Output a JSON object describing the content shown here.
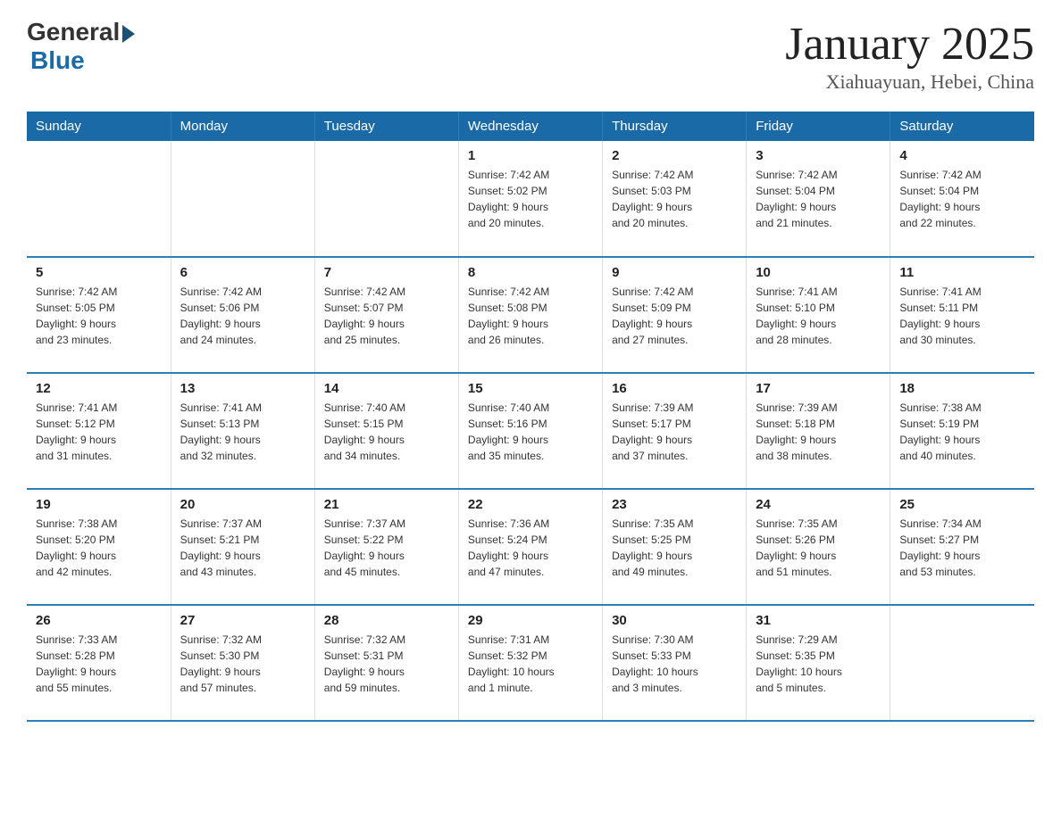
{
  "logo": {
    "general": "General",
    "blue": "Blue"
  },
  "title": "January 2025",
  "subtitle": "Xiahuayuan, Hebei, China",
  "days_of_week": [
    "Sunday",
    "Monday",
    "Tuesday",
    "Wednesday",
    "Thursday",
    "Friday",
    "Saturday"
  ],
  "weeks": [
    [
      {
        "day": "",
        "info": ""
      },
      {
        "day": "",
        "info": ""
      },
      {
        "day": "",
        "info": ""
      },
      {
        "day": "1",
        "info": "Sunrise: 7:42 AM\nSunset: 5:02 PM\nDaylight: 9 hours\nand 20 minutes."
      },
      {
        "day": "2",
        "info": "Sunrise: 7:42 AM\nSunset: 5:03 PM\nDaylight: 9 hours\nand 20 minutes."
      },
      {
        "day": "3",
        "info": "Sunrise: 7:42 AM\nSunset: 5:04 PM\nDaylight: 9 hours\nand 21 minutes."
      },
      {
        "day": "4",
        "info": "Sunrise: 7:42 AM\nSunset: 5:04 PM\nDaylight: 9 hours\nand 22 minutes."
      }
    ],
    [
      {
        "day": "5",
        "info": "Sunrise: 7:42 AM\nSunset: 5:05 PM\nDaylight: 9 hours\nand 23 minutes."
      },
      {
        "day": "6",
        "info": "Sunrise: 7:42 AM\nSunset: 5:06 PM\nDaylight: 9 hours\nand 24 minutes."
      },
      {
        "day": "7",
        "info": "Sunrise: 7:42 AM\nSunset: 5:07 PM\nDaylight: 9 hours\nand 25 minutes."
      },
      {
        "day": "8",
        "info": "Sunrise: 7:42 AM\nSunset: 5:08 PM\nDaylight: 9 hours\nand 26 minutes."
      },
      {
        "day": "9",
        "info": "Sunrise: 7:42 AM\nSunset: 5:09 PM\nDaylight: 9 hours\nand 27 minutes."
      },
      {
        "day": "10",
        "info": "Sunrise: 7:41 AM\nSunset: 5:10 PM\nDaylight: 9 hours\nand 28 minutes."
      },
      {
        "day": "11",
        "info": "Sunrise: 7:41 AM\nSunset: 5:11 PM\nDaylight: 9 hours\nand 30 minutes."
      }
    ],
    [
      {
        "day": "12",
        "info": "Sunrise: 7:41 AM\nSunset: 5:12 PM\nDaylight: 9 hours\nand 31 minutes."
      },
      {
        "day": "13",
        "info": "Sunrise: 7:41 AM\nSunset: 5:13 PM\nDaylight: 9 hours\nand 32 minutes."
      },
      {
        "day": "14",
        "info": "Sunrise: 7:40 AM\nSunset: 5:15 PM\nDaylight: 9 hours\nand 34 minutes."
      },
      {
        "day": "15",
        "info": "Sunrise: 7:40 AM\nSunset: 5:16 PM\nDaylight: 9 hours\nand 35 minutes."
      },
      {
        "day": "16",
        "info": "Sunrise: 7:39 AM\nSunset: 5:17 PM\nDaylight: 9 hours\nand 37 minutes."
      },
      {
        "day": "17",
        "info": "Sunrise: 7:39 AM\nSunset: 5:18 PM\nDaylight: 9 hours\nand 38 minutes."
      },
      {
        "day": "18",
        "info": "Sunrise: 7:38 AM\nSunset: 5:19 PM\nDaylight: 9 hours\nand 40 minutes."
      }
    ],
    [
      {
        "day": "19",
        "info": "Sunrise: 7:38 AM\nSunset: 5:20 PM\nDaylight: 9 hours\nand 42 minutes."
      },
      {
        "day": "20",
        "info": "Sunrise: 7:37 AM\nSunset: 5:21 PM\nDaylight: 9 hours\nand 43 minutes."
      },
      {
        "day": "21",
        "info": "Sunrise: 7:37 AM\nSunset: 5:22 PM\nDaylight: 9 hours\nand 45 minutes."
      },
      {
        "day": "22",
        "info": "Sunrise: 7:36 AM\nSunset: 5:24 PM\nDaylight: 9 hours\nand 47 minutes."
      },
      {
        "day": "23",
        "info": "Sunrise: 7:35 AM\nSunset: 5:25 PM\nDaylight: 9 hours\nand 49 minutes."
      },
      {
        "day": "24",
        "info": "Sunrise: 7:35 AM\nSunset: 5:26 PM\nDaylight: 9 hours\nand 51 minutes."
      },
      {
        "day": "25",
        "info": "Sunrise: 7:34 AM\nSunset: 5:27 PM\nDaylight: 9 hours\nand 53 minutes."
      }
    ],
    [
      {
        "day": "26",
        "info": "Sunrise: 7:33 AM\nSunset: 5:28 PM\nDaylight: 9 hours\nand 55 minutes."
      },
      {
        "day": "27",
        "info": "Sunrise: 7:32 AM\nSunset: 5:30 PM\nDaylight: 9 hours\nand 57 minutes."
      },
      {
        "day": "28",
        "info": "Sunrise: 7:32 AM\nSunset: 5:31 PM\nDaylight: 9 hours\nand 59 minutes."
      },
      {
        "day": "29",
        "info": "Sunrise: 7:31 AM\nSunset: 5:32 PM\nDaylight: 10 hours\nand 1 minute."
      },
      {
        "day": "30",
        "info": "Sunrise: 7:30 AM\nSunset: 5:33 PM\nDaylight: 10 hours\nand 3 minutes."
      },
      {
        "day": "31",
        "info": "Sunrise: 7:29 AM\nSunset: 5:35 PM\nDaylight: 10 hours\nand 5 minutes."
      },
      {
        "day": "",
        "info": ""
      }
    ]
  ]
}
